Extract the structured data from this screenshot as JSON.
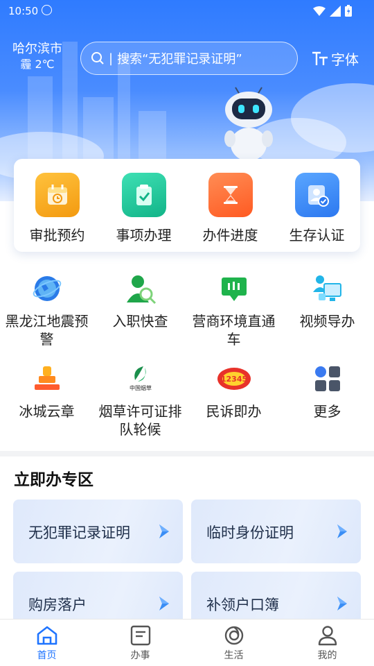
{
  "status_bar": {
    "time": "10:50",
    "nfc_icon": "nfc-icon",
    "wifi_icon": "wifi-icon",
    "signal_icon": "signal-icon",
    "battery_icon": "battery-icon"
  },
  "header": {
    "city": "哈尔滨市",
    "weather": "霾 2℃",
    "search_placeholder": "搜索“无犯罪记录证明”",
    "font_label": "字体",
    "search_icon": "search-icon",
    "font_icon": "font-size-icon"
  },
  "quick_card": [
    {
      "label": "审批预约",
      "icon": "calendar-icon",
      "color": "#f7a81c"
    },
    {
      "label": "事项办理",
      "icon": "clipboard-check-icon",
      "color": "#1fc49a"
    },
    {
      "label": "办件进度",
      "icon": "hourglass-icon",
      "color": "#ff6a33"
    },
    {
      "label": "生存认证",
      "icon": "user-verify-icon",
      "color": "#3a8dff"
    }
  ],
  "services": [
    {
      "label": "黑龙江地震预警",
      "icon": "earth-icon"
    },
    {
      "label": "入职快查",
      "icon": "person-search-icon"
    },
    {
      "label": "营商环境直通车",
      "icon": "chat-bubble-icon"
    },
    {
      "label": "视频导办",
      "icon": "video-monitor-icon"
    },
    {
      "label": "冰城云章",
      "icon": "stamp-icon"
    },
    {
      "label": "烟草许可证排队轮候",
      "icon": "tobacco-logo-icon",
      "logo_text": "中国烟草"
    },
    {
      "label": "民诉即办",
      "icon": "hotline-12345-icon",
      "logo_text": "12345"
    },
    {
      "label": "更多",
      "icon": "more-grid-icon"
    }
  ],
  "zone": {
    "title": "立即办专区",
    "tiles": [
      {
        "label": "无犯罪记录证明",
        "icon": "chevron-right-icon"
      },
      {
        "label": "临时身份证明",
        "icon": "chevron-right-icon"
      },
      {
        "label": "购房落户",
        "icon": "chevron-right-icon"
      },
      {
        "label": "补领户口簿",
        "icon": "chevron-right-icon"
      }
    ]
  },
  "tabbar": [
    {
      "label": "首页",
      "icon": "home-icon",
      "active": true
    },
    {
      "label": "办事",
      "icon": "document-icon",
      "active": false
    },
    {
      "label": "生活",
      "icon": "life-icon",
      "active": false
    },
    {
      "label": "我的",
      "icon": "person-icon",
      "active": false
    }
  ],
  "colors": {
    "primary": "#1f74ff",
    "hero_top": "#2f7bff"
  }
}
